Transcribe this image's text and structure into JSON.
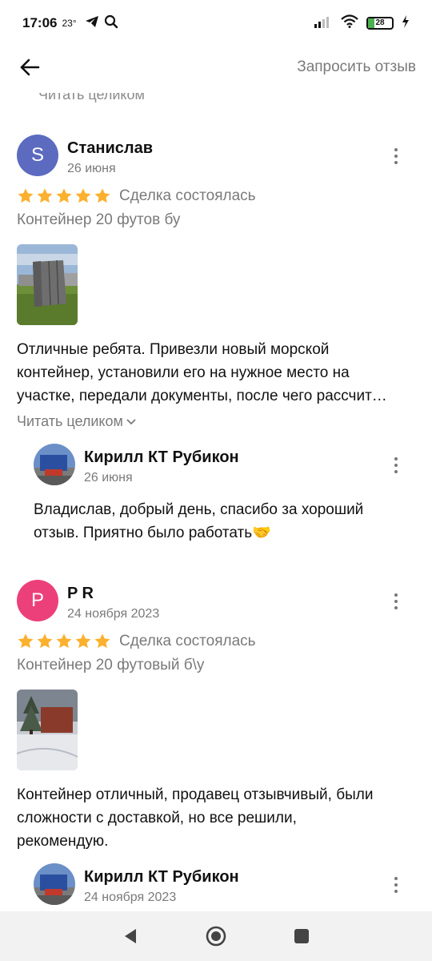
{
  "status": {
    "time": "17:06",
    "temp": "23°",
    "battery": "28",
    "battery_level": 0.28,
    "icons": [
      "telegram-icon",
      "search-icon",
      "signal-icon",
      "wifi-icon",
      "battery-icon",
      "charging-icon"
    ]
  },
  "header": {
    "back_icon": "arrow-left-icon",
    "action": "Запросить отзыв"
  },
  "cut_text": "Читать целиком",
  "reviews": [
    {
      "avatar_letter": "S",
      "avatar_color": "#5c6bc0",
      "author": "Станислав",
      "date": "26 июня",
      "rating": 5,
      "deal": "Сделка состоялась",
      "product": "Контейнер 20 футов бу",
      "text_lines": [
        "Отличные ребята. Привезли новый морской",
        "контейнер, установили его на нужное место на",
        "участке, передали документы, после чего рассчит…"
      ],
      "read_more": "Читать целиком",
      "reply": {
        "author": "Кирилл КТ Рубикон",
        "date": "26 июня",
        "text_lines": [
          "Владислав, добрый день, спасибо за хороший",
          "отзыв. Приятно было работать🤝"
        ]
      }
    },
    {
      "avatar_letter": "P",
      "avatar_color": "#ec407a",
      "author": "P R",
      "date": "24 ноября 2023",
      "rating": 5,
      "deal": "Сделка состоялась",
      "product": "Контейнер 20 футовый б\\у",
      "text_lines": [
        "Контейнер отличный, продавец отзывчивый, были",
        "сложности с доставкой, но все решили,",
        "рекомендую."
      ],
      "reply": {
        "author": "Кирилл КТ Рубикон",
        "date": "24 ноября 2023"
      }
    }
  ],
  "colors": {
    "star": "#fbb02e",
    "muted": "#7a7a7a",
    "nav_bg": "#f2f2f2"
  },
  "nav": {
    "icons": [
      "back-triangle-icon",
      "home-circle-icon",
      "recents-square-icon"
    ]
  }
}
